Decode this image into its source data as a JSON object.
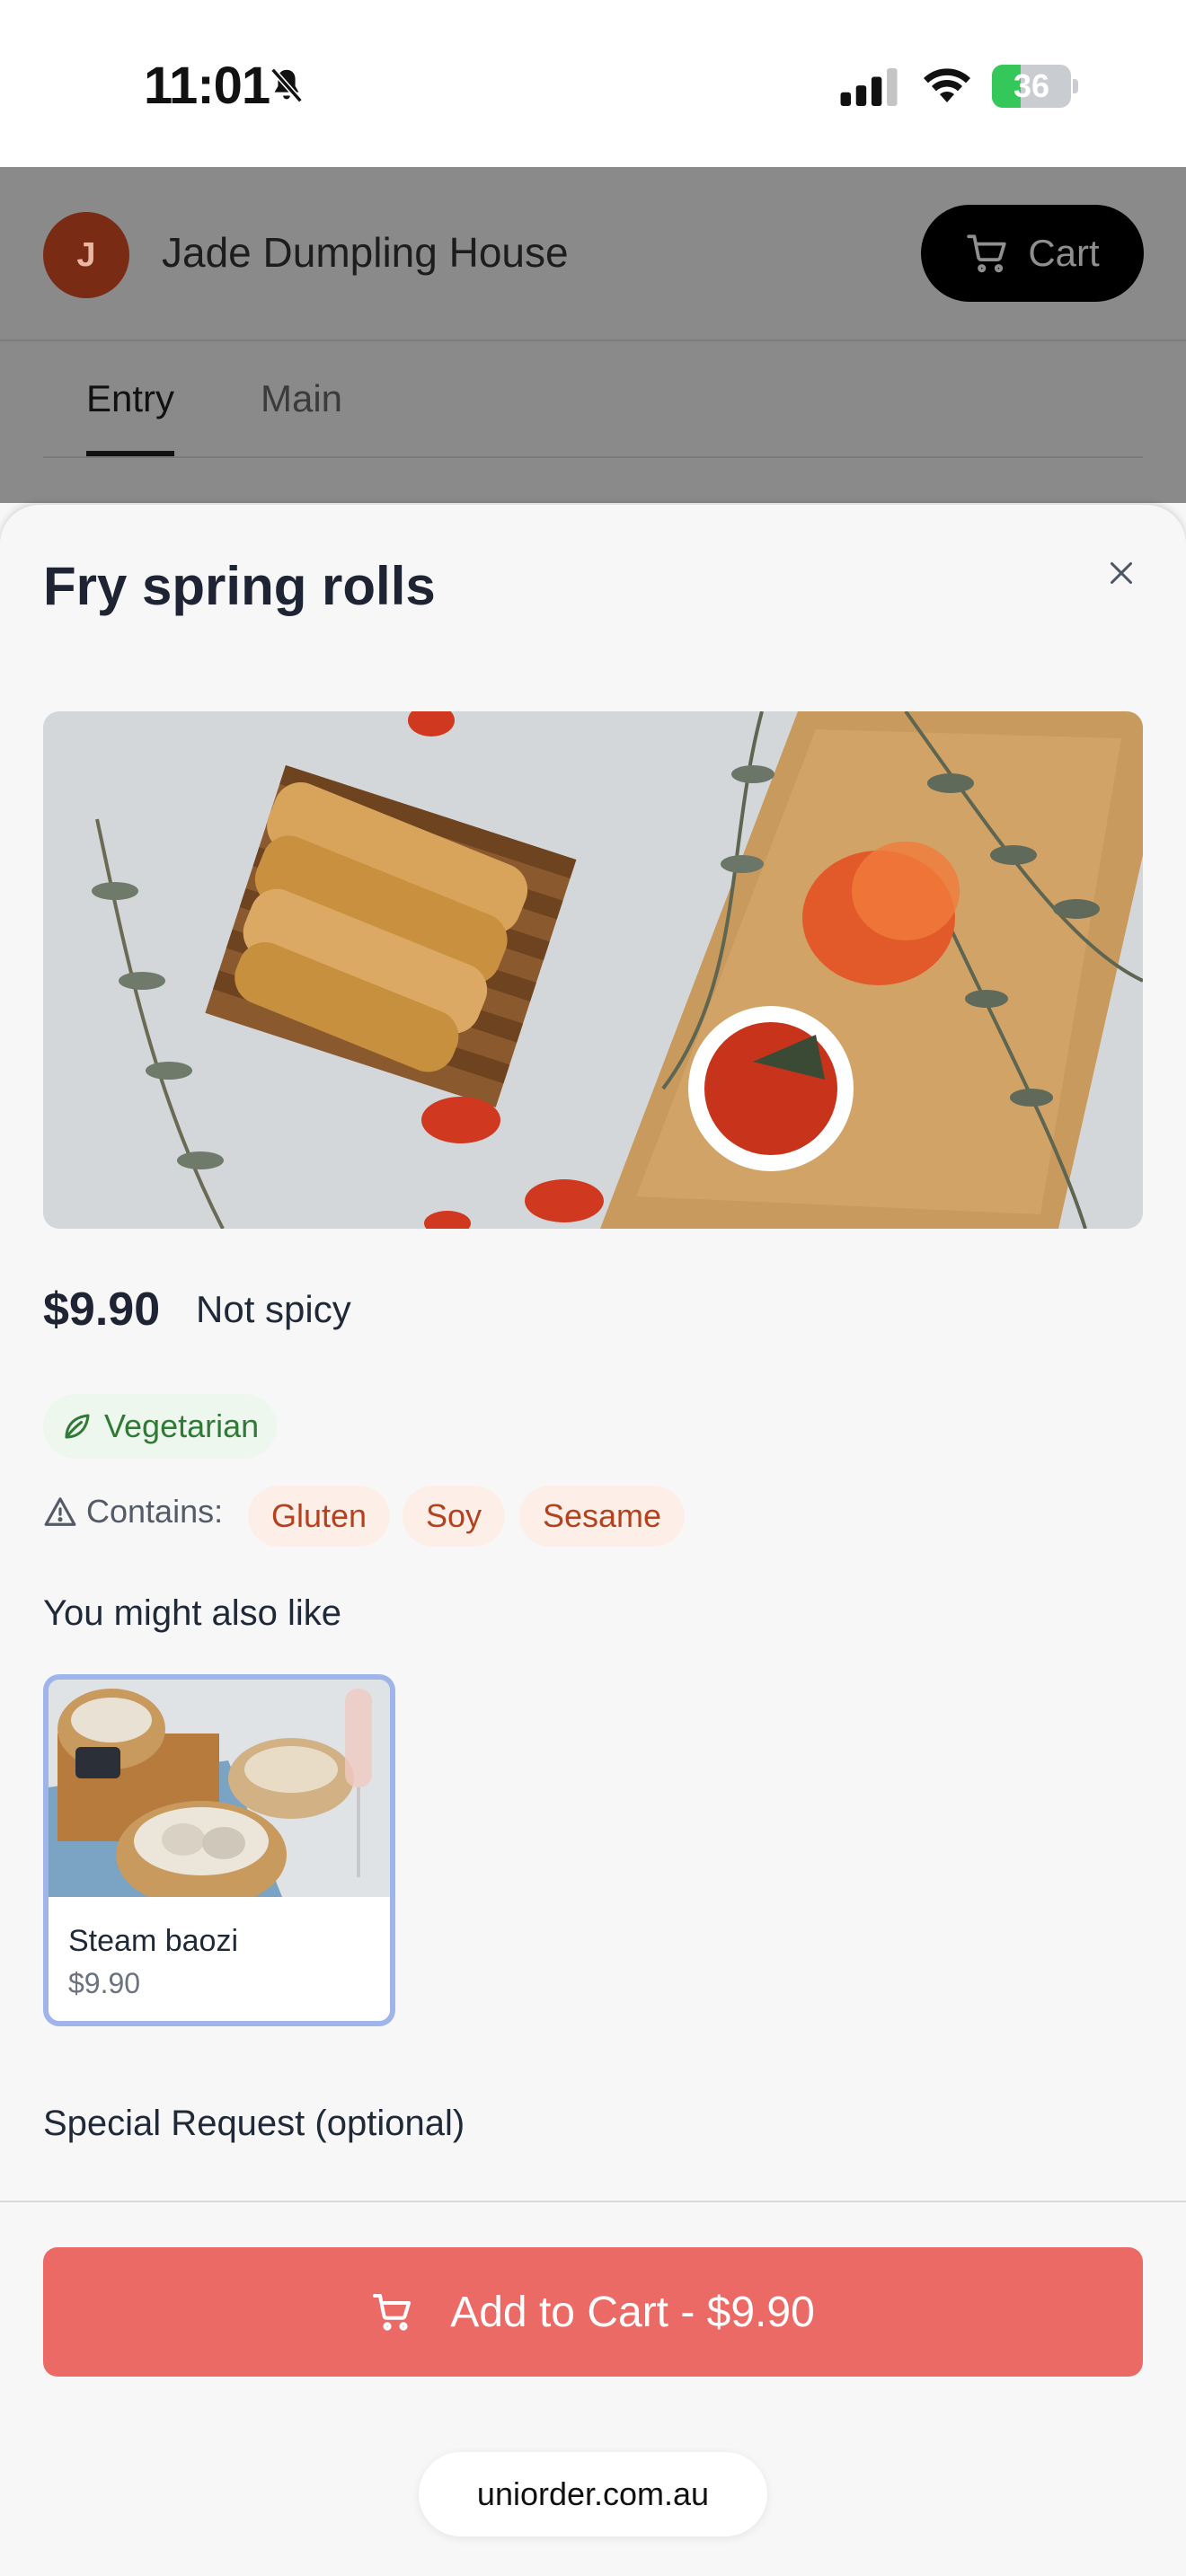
{
  "status_bar": {
    "time": "11:01",
    "battery_level": "36",
    "battery_fraction": 0.36
  },
  "header": {
    "avatar_initial": "J",
    "restaurant_name": "Jade Dumpling House",
    "cart_label": "Cart"
  },
  "tabs": [
    {
      "label": "Entry",
      "active": true
    },
    {
      "label": "Main",
      "active": false
    }
  ],
  "item": {
    "title": "Fry spring rolls",
    "price": "$9.90",
    "spice_level": "Not spicy",
    "diet_badge": "Vegetarian",
    "contains_label": "Contains:",
    "allergens": [
      "Gluten",
      "Soy",
      "Sesame"
    ]
  },
  "recommendations": {
    "heading": "You might also like",
    "items": [
      {
        "name": "Steam baozi",
        "price": "$9.90"
      }
    ]
  },
  "special_request": {
    "label": "Special Request (optional)"
  },
  "actions": {
    "add_to_cart": "Add to Cart - $9.90"
  },
  "browser": {
    "url": "uniorder.com.au"
  },
  "colors": {
    "accent": "#ec6a66",
    "veg_green": "#2f7a36",
    "allergen_text": "#b5421f",
    "avatar_bg": "#7a2b14"
  },
  "icons": {
    "status": [
      "bell-slash-icon",
      "signal-icon",
      "wifi-icon",
      "battery-icon"
    ],
    "cart": "cart-icon",
    "close": "close-icon",
    "vegetarian": "leaf-icon",
    "warning": "warning-icon"
  }
}
